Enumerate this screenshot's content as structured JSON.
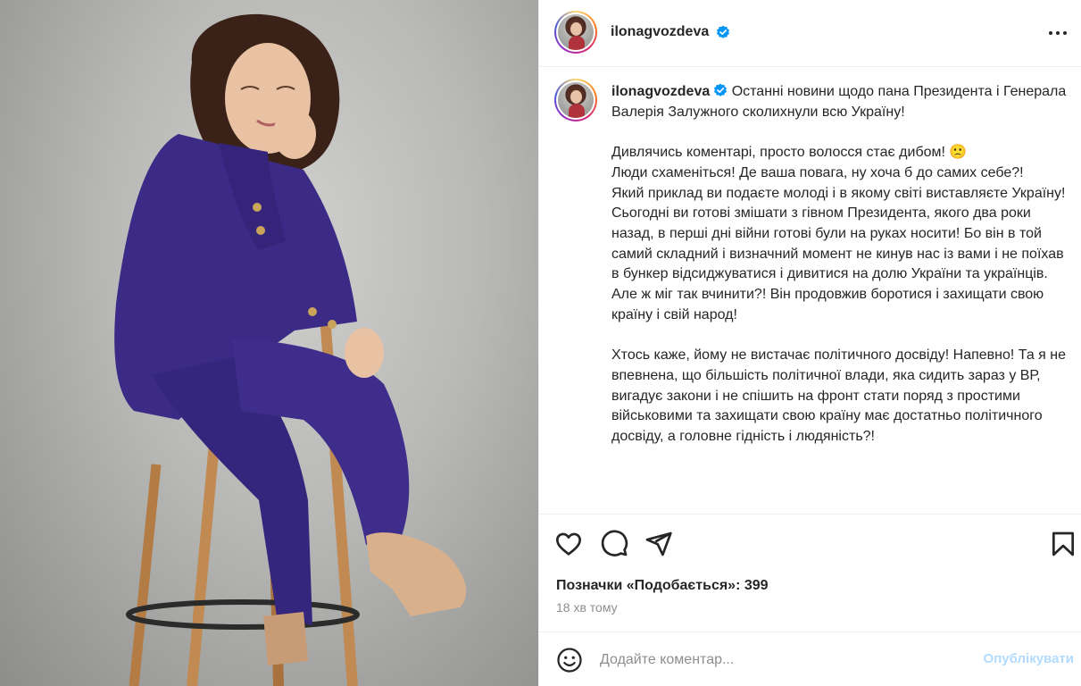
{
  "post": {
    "username": "ilonagvozdeva",
    "more_icon": "more-horizontal-icon"
  },
  "caption": {
    "username": "ilonagvozdeva",
    "line1": " Останні новини щодо пана Президента і Генерала Валерія Залужного сколихнули всю Україну!",
    "para2": "Дивлячись коментарі, просто волосся стає дибом! 🙁\nЛюди схаменіться! Де ваша повага, ну хоча б до самих себе?!\nЯкий приклад ви подаєте молоді і в якому світі виставляєте Україну! Сьогодні ви готові змішати з гівном Президента, якого два роки назад, в перші дні війни готові були на руках носити! Бо він в той самий складний і визначний момент не кинув нас із вами і не поїхав в бункер відсиджуватися і дивитися на долю України та українців. Але ж міг так вчинити?! Він продовжив боротися і захищати свою країну і свій народ!",
    "para3": "Хтось каже, йому не вистачає політичного досвіду! Напевно! Та я не впевнена, що більшість політичної влади, яка сидить зараз у ВР, вигадує закони і не спішить на фронт стати поряд з простими військовими та захищати свою країну має достатньо політичного досвіду, а головне гідність і людяність?!"
  },
  "actions": {
    "like_icon": "heart-icon",
    "comment_icon": "comment-icon",
    "share_icon": "send-icon",
    "save_icon": "bookmark-icon"
  },
  "likes": "Позначки «Подобається»: 399",
  "time": "18 хв тому",
  "comment": {
    "placeholder": "Додайте коментар...",
    "publish": "Опублікувати"
  },
  "colors": {
    "verified": "#0095f6",
    "suit": "#3b2a86",
    "publish_disabled": "#b3dbff"
  }
}
